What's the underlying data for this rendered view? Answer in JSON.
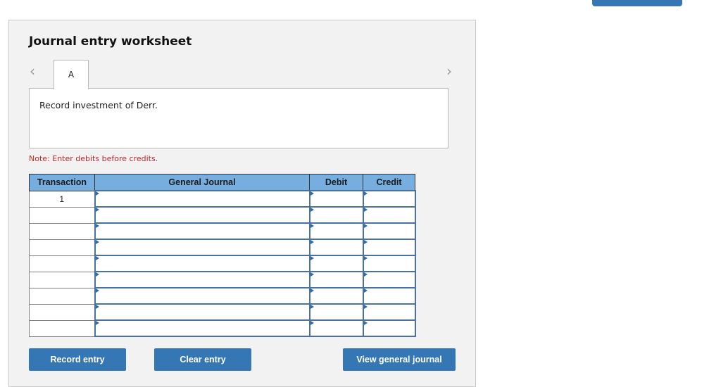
{
  "top_button": {
    "label": ""
  },
  "worksheet": {
    "title": "Journal entry worksheet",
    "nav": {
      "prev_icon": "chevron-left-icon",
      "next_icon": "chevron-right-icon"
    },
    "tabs": [
      {
        "label": "A",
        "active": true
      }
    ],
    "description": "Record investment of Derr.",
    "note": "Note: Enter debits before credits."
  },
  "table": {
    "headers": [
      "Transaction",
      "General Journal",
      "Debit",
      "Credit"
    ],
    "rows": [
      {
        "transaction": "1",
        "account": "",
        "debit": "",
        "credit": ""
      },
      {
        "transaction": "",
        "account": "",
        "debit": "",
        "credit": ""
      },
      {
        "transaction": "",
        "account": "",
        "debit": "",
        "credit": ""
      },
      {
        "transaction": "",
        "account": "",
        "debit": "",
        "credit": ""
      },
      {
        "transaction": "",
        "account": "",
        "debit": "",
        "credit": ""
      },
      {
        "transaction": "",
        "account": "",
        "debit": "",
        "credit": ""
      },
      {
        "transaction": "",
        "account": "",
        "debit": "",
        "credit": ""
      },
      {
        "transaction": "",
        "account": "",
        "debit": "",
        "credit": ""
      },
      {
        "transaction": "",
        "account": "",
        "debit": "",
        "credit": ""
      }
    ]
  },
  "buttons": {
    "record": "Record entry",
    "clear": "Clear entry",
    "view": "View general journal"
  },
  "colors": {
    "button": "#3577b5",
    "header": "#77aee0",
    "note": "#c1272d",
    "panel": "#f2f2f2"
  }
}
